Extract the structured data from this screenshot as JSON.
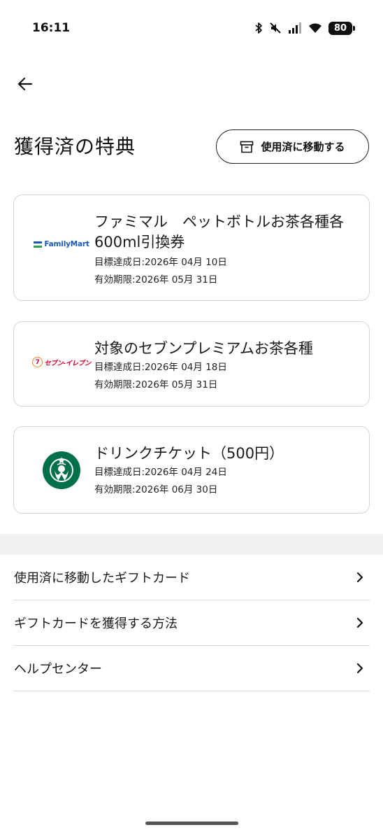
{
  "status_bar": {
    "time": "16:11",
    "battery": "80",
    "icons": [
      "bluetooth-icon",
      "mute-icon",
      "signal-icon",
      "wifi-icon",
      "battery-icon"
    ]
  },
  "header": {
    "back_icon": "arrow-left-icon",
    "title": "獲得済の特典",
    "move_button_label": "使用済に移動する",
    "move_button_icon": "archive-box-icon"
  },
  "rewards": [
    {
      "brand": "FamilyMart",
      "title": "ファミマル　ペットボトルお茶各種各600ml引換券",
      "achieved": "目標達成日:2026年 04月 10日",
      "expires": "有効期限:2026年 05月 31日"
    },
    {
      "brand": "セブン-イレブン",
      "brand_badge": "7",
      "title": "対象のセブンプレミアムお茶各種",
      "achieved": "目標達成日:2026年 04月 18日",
      "expires": "有効期限:2026年 05月 31日"
    },
    {
      "brand": "Starbucks",
      "title": "ドリンクチケット（500円）",
      "achieved": "目標達成日:2026年 04月 24日",
      "expires": "有効期限:2026年 06月 30日"
    }
  ],
  "menu": [
    {
      "label": "使用済に移動したギフトカード",
      "icon": "chevron-right-icon"
    },
    {
      "label": "ギフトカードを獲得する方法",
      "icon": "chevron-right-icon"
    },
    {
      "label": "ヘルプセンター",
      "icon": "chevron-right-icon"
    }
  ],
  "colors": {
    "familymart_blue": "#1a5bb4",
    "familymart_green": "#2ca24c",
    "seven_red": "#e4002b",
    "seven_orange": "#f58220",
    "starbucks_green": "#00704a",
    "card_border": "#d6d6d6",
    "band": "#f1f1f1"
  }
}
